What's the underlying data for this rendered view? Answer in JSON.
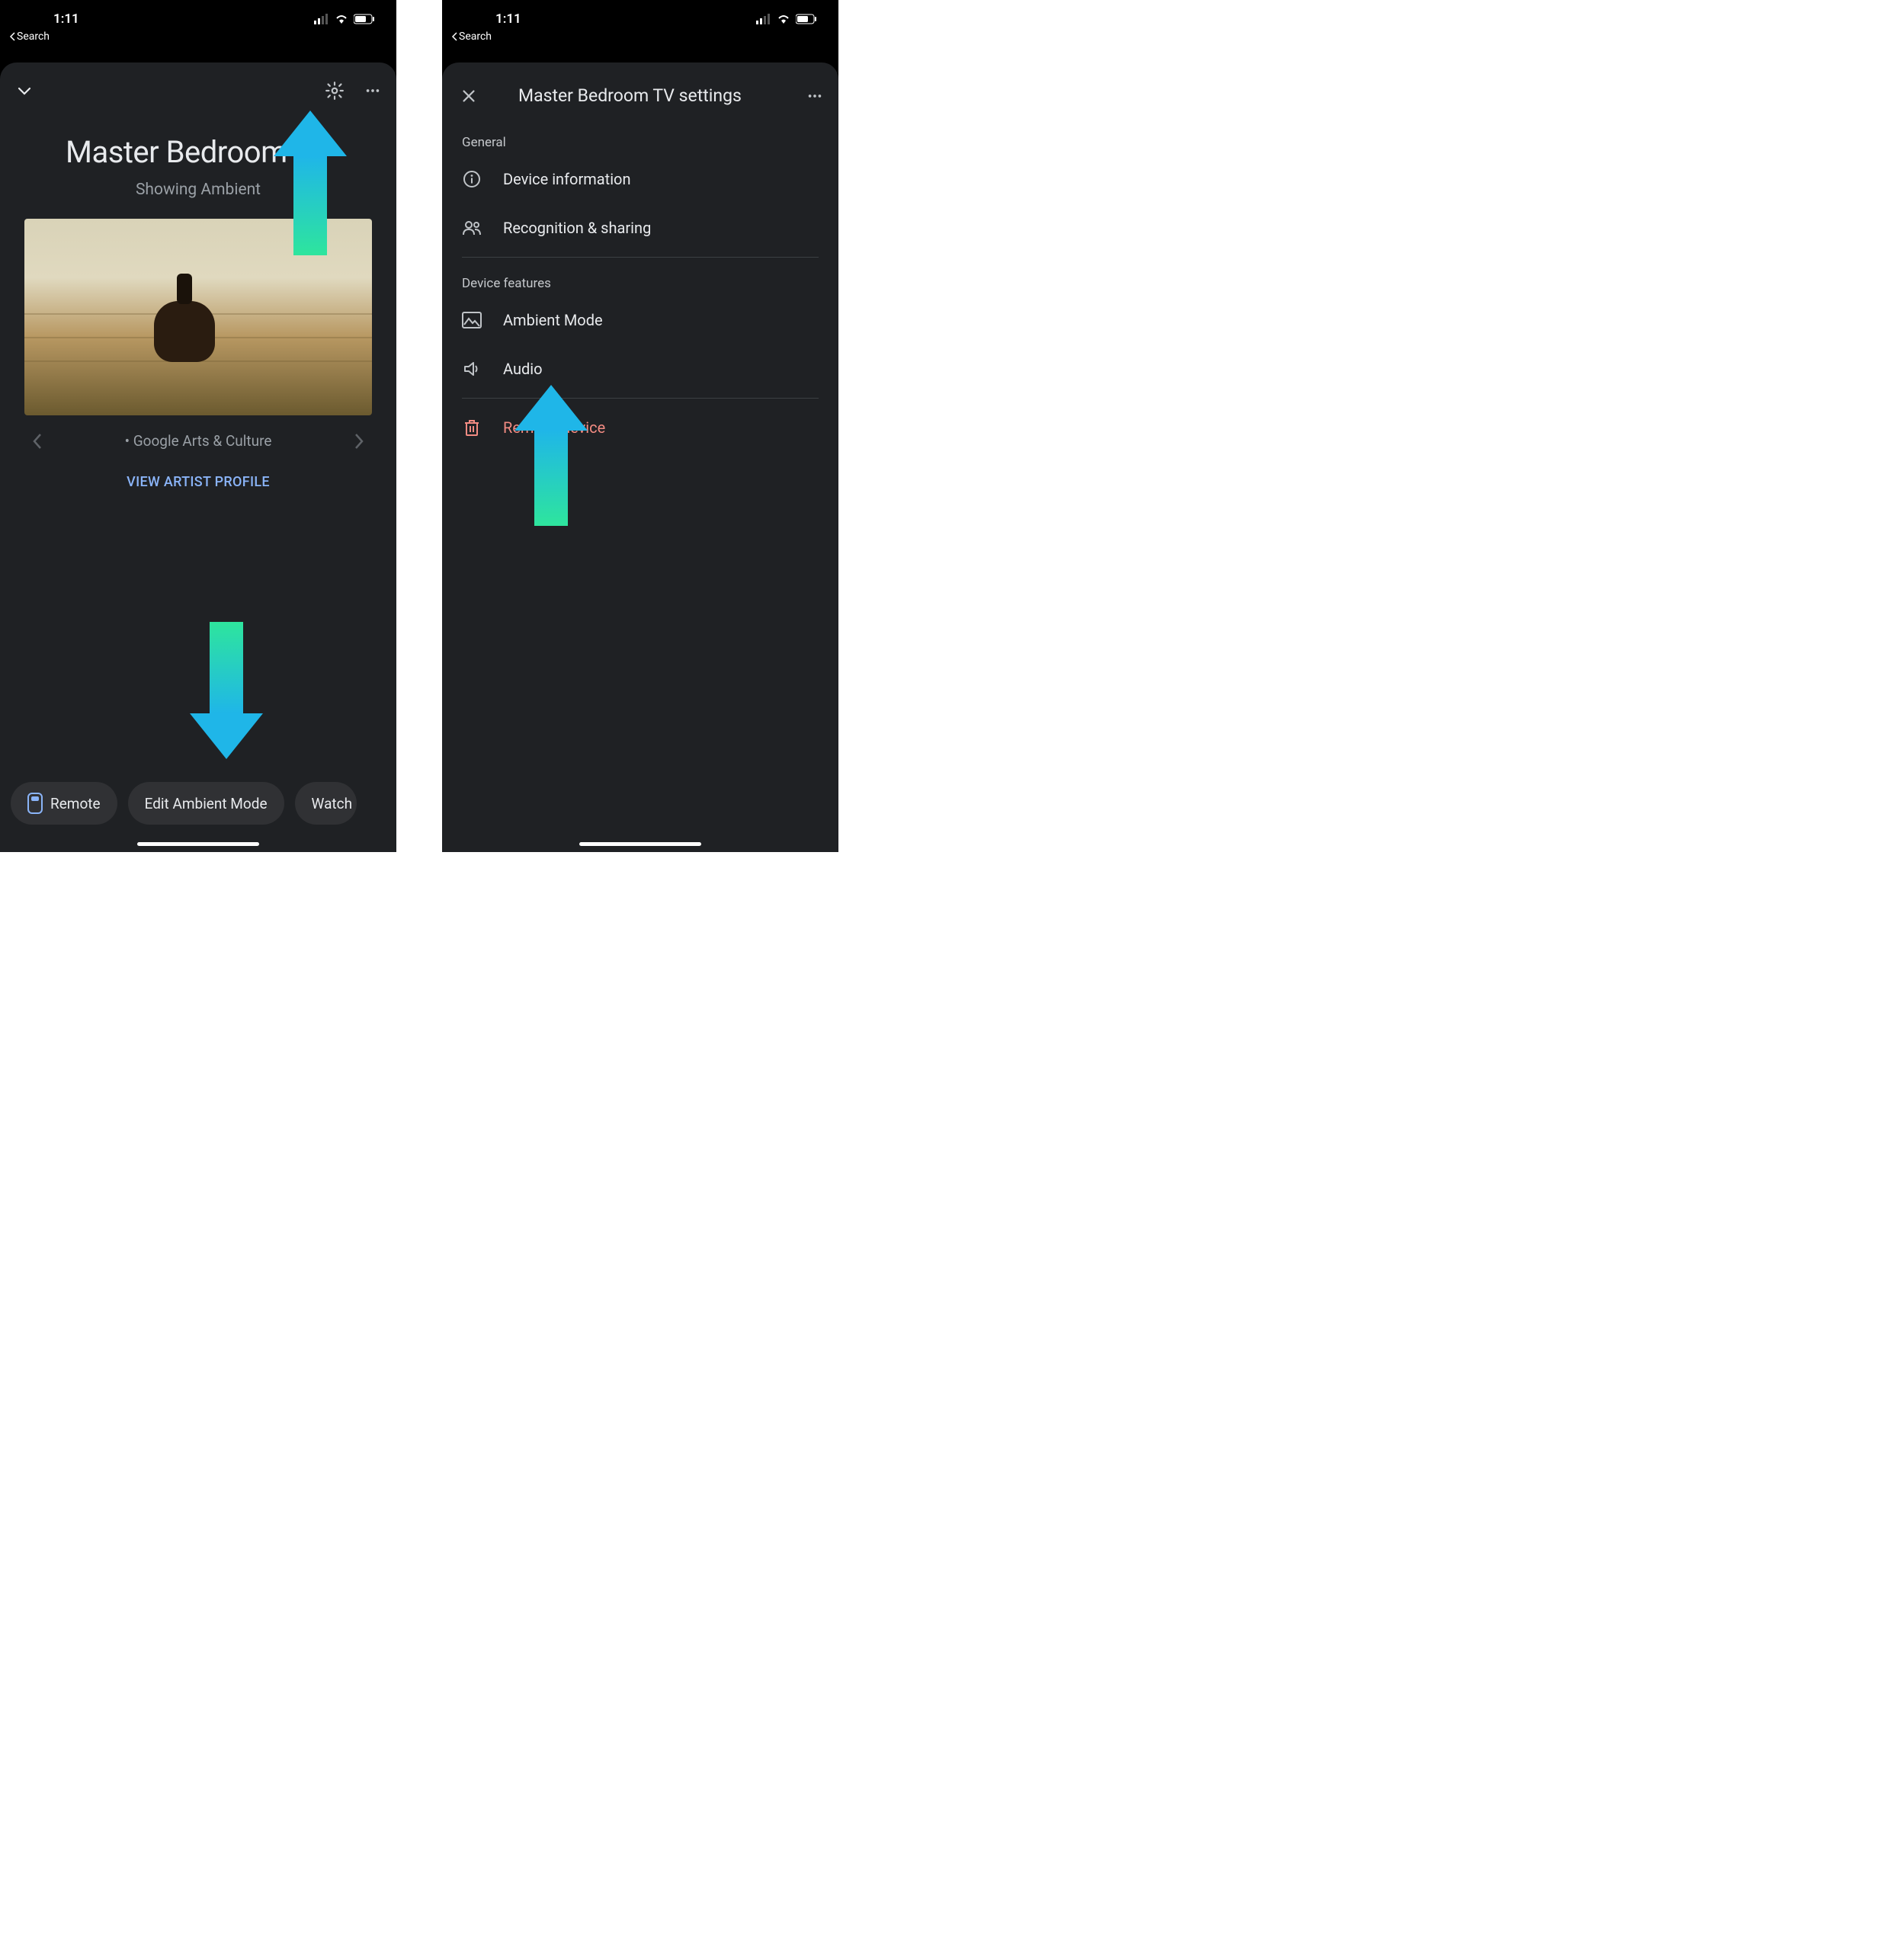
{
  "status": {
    "time": "1:11",
    "back_label": "Search"
  },
  "screen1": {
    "title": "Master Bedroom TV",
    "subtitle": "Showing Ambient",
    "carousel_caption": "Google Arts & Culture",
    "view_profile": "VIEW ARTIST PROFILE",
    "chips": {
      "remote": "Remote",
      "edit_ambient": "Edit Ambient Mode",
      "watch": "Watch"
    }
  },
  "screen2": {
    "title": "Master Bedroom TV settings",
    "sections": {
      "general": "General",
      "features": "Device features"
    },
    "items": {
      "device_info": "Device information",
      "recognition": "Recognition & sharing",
      "ambient": "Ambient Mode",
      "audio": "Audio",
      "remove": "Remove device"
    }
  }
}
